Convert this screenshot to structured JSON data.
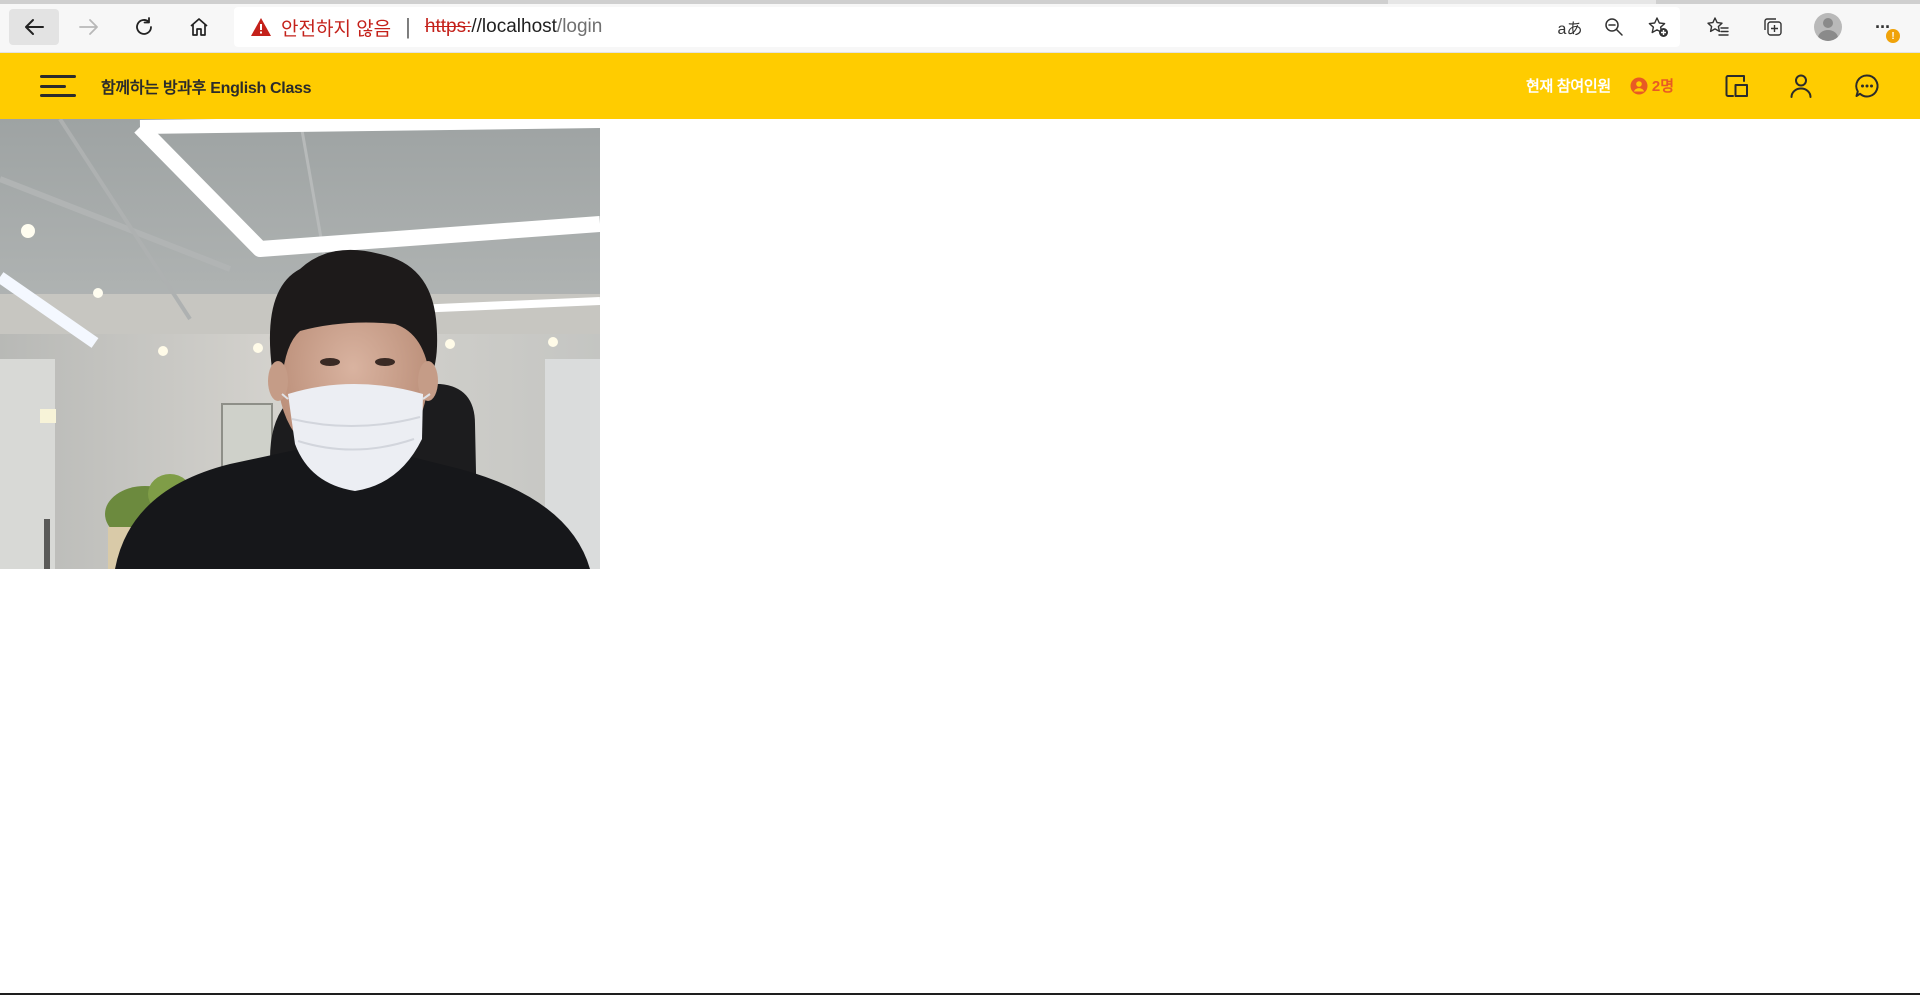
{
  "browser": {
    "security_warning": "안전하지 않음",
    "url": {
      "scheme": "https:",
      "host": "//localhost",
      "path": "/login"
    },
    "icons": {
      "back": "back-arrow-icon",
      "forward": "forward-arrow-icon",
      "reload": "reload-icon",
      "home": "home-icon",
      "warning": "warning-triangle-icon",
      "read_aloud": "read-aloud-icon",
      "zoom": "zoom-out-icon",
      "favorite": "add-favorite-icon",
      "favorites": "favorites-icon",
      "collections": "collections-icon",
      "profile": "profile-avatar-icon",
      "more": "more-menu-icon"
    },
    "read_aloud_glyph": "aあ",
    "more_glyph": "···",
    "notification_badge": "!"
  },
  "header": {
    "title": "함께하는 방과후 English Class",
    "participants_label": "현재 참여인원",
    "participants_count": "2명",
    "colors": {
      "background": "#ffcc00",
      "count": "#e85a24"
    },
    "icons": [
      "menu-icon",
      "participant-icon",
      "screen-share-icon",
      "user-icon",
      "chat-icon"
    ]
  },
  "main": {
    "video": {
      "alt": "webcam feed"
    }
  }
}
